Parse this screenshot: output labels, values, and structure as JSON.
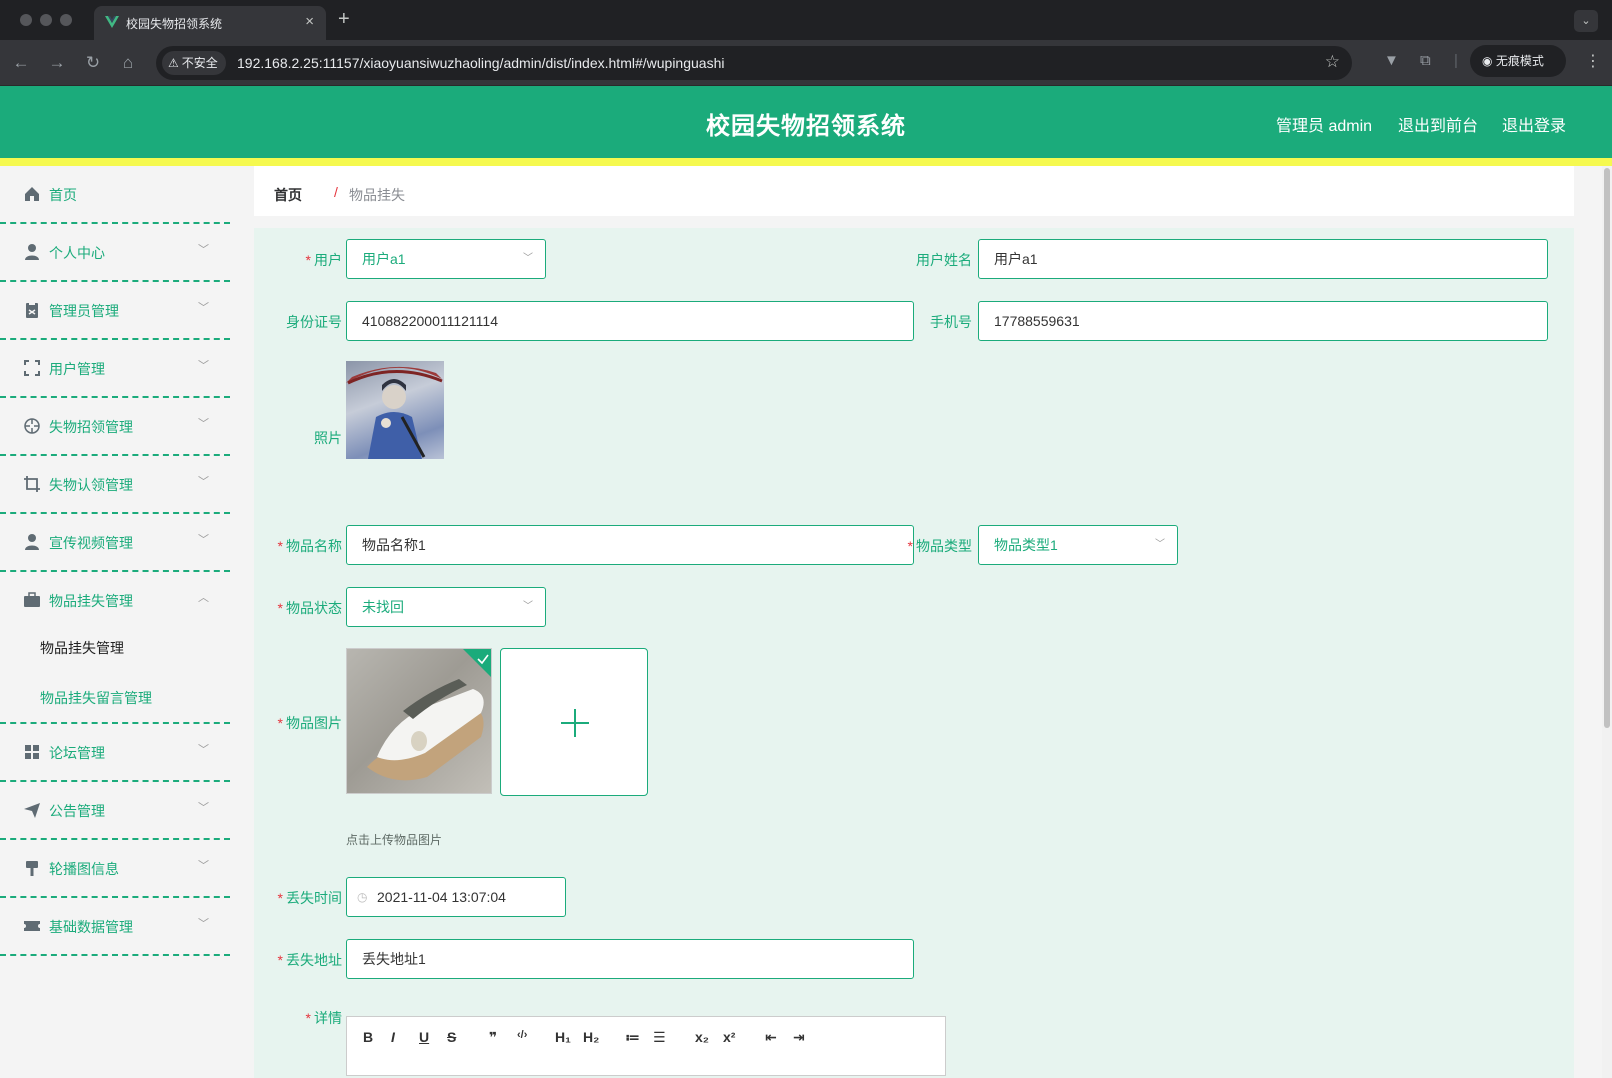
{
  "browser": {
    "tab_title": "校园失物招领系统",
    "tab_close": "×",
    "new_tab": "+",
    "tab_list": "⌄",
    "security_label": "不安全",
    "url": "192.168.2.25:11157/xiaoyuansiwuzhaoling/admin/dist/index.html#/wupinguashi",
    "incognito_label": "无痕模式"
  },
  "header": {
    "title": "校园失物招领系统",
    "admin_label": "管理员 admin",
    "to_front": "退出到前台",
    "logout": "退出登录"
  },
  "colors": {
    "accent": "#1bab7b",
    "strip": "#f5f94f",
    "required": "#e5343d"
  },
  "sidebar": {
    "items": [
      {
        "label": "首页",
        "icon": "home-icon"
      },
      {
        "label": "个人中心",
        "icon": "user-icon"
      },
      {
        "label": "管理员管理",
        "icon": "clipboard-icon"
      },
      {
        "label": "用户管理",
        "icon": "frame-icon"
      },
      {
        "label": "失物招领管理",
        "icon": "target-icon"
      },
      {
        "label": "失物认领管理",
        "icon": "crop-icon"
      },
      {
        "label": "宣传视频管理",
        "icon": "user-icon"
      },
      {
        "label": "物品挂失管理",
        "icon": "briefcase-icon"
      },
      {
        "label": "论坛管理",
        "icon": "grid-icon"
      },
      {
        "label": "公告管理",
        "icon": "send-icon"
      },
      {
        "label": "轮播图信息",
        "icon": "brush-icon"
      },
      {
        "label": "基础数据管理",
        "icon": "ticket-icon"
      }
    ],
    "submenu": [
      "物品挂失管理",
      "物品挂失留言管理"
    ]
  },
  "breadcrumb": {
    "home": "首页",
    "separator": "/",
    "current": "物品挂失"
  },
  "form": {
    "user_label": "用户",
    "user_value": "用户a1",
    "username_label": "用户姓名",
    "username_value": "用户a1",
    "idcard_label": "身份证号",
    "idcard_value": "410882200011121114",
    "phone_label": "手机号",
    "phone_value": "17788559631",
    "photo_label": "照片",
    "item_name_label": "物品名称",
    "item_name_value": "物品名称1",
    "item_type_label": "物品类型",
    "item_type_value": "物品类型1",
    "item_status_label": "物品状态",
    "item_status_value": "未找回",
    "item_image_label": "物品图片",
    "upload_tip": "点击上传物品图片",
    "lost_time_label": "丢失时间",
    "lost_time_value": "2021-11-04 13:07:04",
    "lost_address_label": "丢失地址",
    "lost_address_value": "丢失地址1",
    "detail_label": "详情",
    "required_mark": "*"
  },
  "editor": {
    "buttons": [
      "B",
      "I",
      "U",
      "S",
      "❞",
      "‹/›",
      "H₁",
      "H₂",
      "≔",
      "☰",
      "x₂",
      "x²",
      "⇤",
      "⇥"
    ]
  }
}
